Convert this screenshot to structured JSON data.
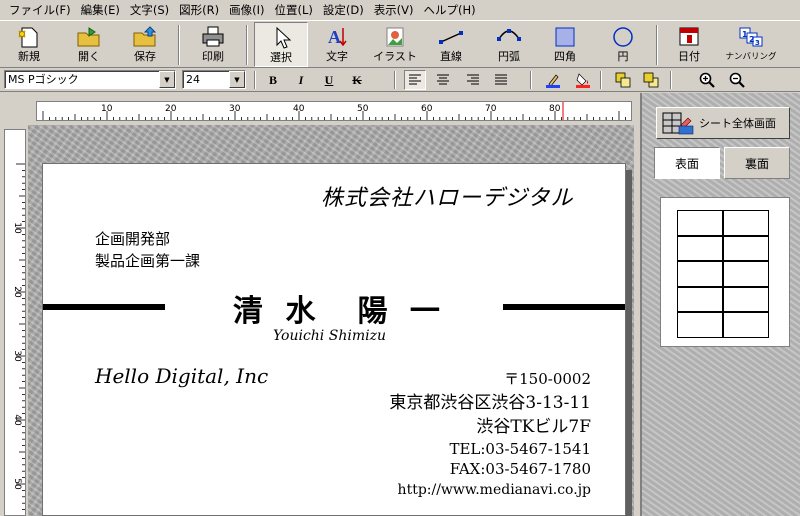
{
  "menu": [
    "ファイル(F)",
    "編集(E)",
    "文字(S)",
    "図形(R)",
    "画像(I)",
    "位置(L)",
    "設定(D)",
    "表示(V)",
    "ヘルプ(H)"
  ],
  "toolbar": {
    "new": "新規",
    "open": "開く",
    "save": "保存",
    "print": "印刷",
    "select": "選択",
    "text": "文字",
    "illust": "イラスト",
    "line": "直線",
    "arc": "円弧",
    "rect": "四角",
    "circle": "円",
    "date": "日付",
    "numbering": "ナンバリング"
  },
  "format": {
    "font": "MS Pゴシック",
    "size": "24",
    "bold": "B",
    "italic": "I",
    "underline": "U",
    "strike": "K"
  },
  "ruler": {
    "h_labels": [
      "10",
      "20",
      "30",
      "40",
      "50",
      "60",
      "70",
      "80"
    ],
    "v_labels": [
      "10",
      "20",
      "30",
      "40",
      "50"
    ]
  },
  "card": {
    "company": "株式会社ハローデジタル",
    "dept1": "企画開発部",
    "dept2": "製品企画第一課",
    "name": "清 水　陽 一",
    "name_roman": "Youichi Shimizu",
    "company_en": "Hello Digital, Inc",
    "postal": "〒150-0002",
    "address1": "東京都渋谷区渋谷3-13-11",
    "address2": "渋谷TKビル7F",
    "tel": "TEL:03-5467-1541",
    "fax": "FAX:03-5467-1780",
    "url": "http://www.medianavi.co.jp"
  },
  "panel": {
    "sheet_view": "シート全体画面",
    "front_tab": "表面",
    "back_tab": "裏面"
  }
}
